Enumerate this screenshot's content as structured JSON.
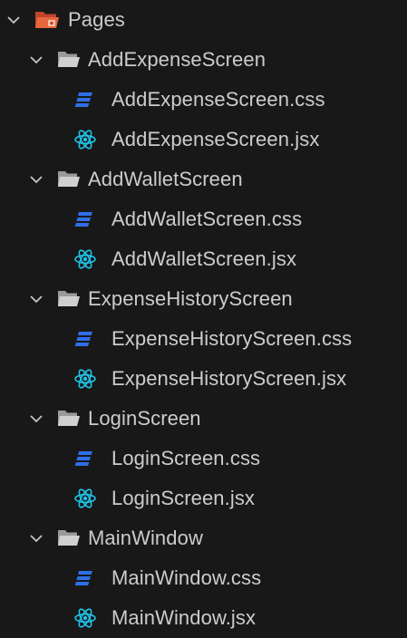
{
  "root": {
    "label": "Pages",
    "icon": "folder-pages-open-icon",
    "accent": "#e8663d",
    "children": [
      {
        "label": "AddExpenseScreen",
        "icon": "folder-open-icon",
        "files": [
          {
            "label": "AddExpenseScreen.css",
            "icon": "css-icon"
          },
          {
            "label": "AddExpenseScreen.jsx",
            "icon": "react-icon"
          }
        ]
      },
      {
        "label": "AddWalletScreen",
        "icon": "folder-open-icon",
        "files": [
          {
            "label": "AddWalletScreen.css",
            "icon": "css-icon"
          },
          {
            "label": "AddWalletScreen.jsx",
            "icon": "react-icon"
          }
        ]
      },
      {
        "label": "ExpenseHistoryScreen",
        "icon": "folder-open-icon",
        "files": [
          {
            "label": "ExpenseHistoryScreen.css",
            "icon": "css-icon"
          },
          {
            "label": "ExpenseHistoryScreen.jsx",
            "icon": "react-icon"
          }
        ]
      },
      {
        "label": "LoginScreen",
        "icon": "folder-open-icon",
        "files": [
          {
            "label": "LoginScreen.css",
            "icon": "css-icon"
          },
          {
            "label": "LoginScreen.jsx",
            "icon": "react-icon"
          }
        ]
      },
      {
        "label": "MainWindow",
        "icon": "folder-open-icon",
        "files": [
          {
            "label": "MainWindow.css",
            "icon": "css-icon"
          },
          {
            "label": "MainWindow.jsx",
            "icon": "react-icon"
          }
        ]
      }
    ]
  },
  "colors": {
    "background": "#181818",
    "text": "#cccccc",
    "css_icon": "#2f6fe8",
    "react_icon": "#20c4e8",
    "folder": "#c9c9c9"
  }
}
